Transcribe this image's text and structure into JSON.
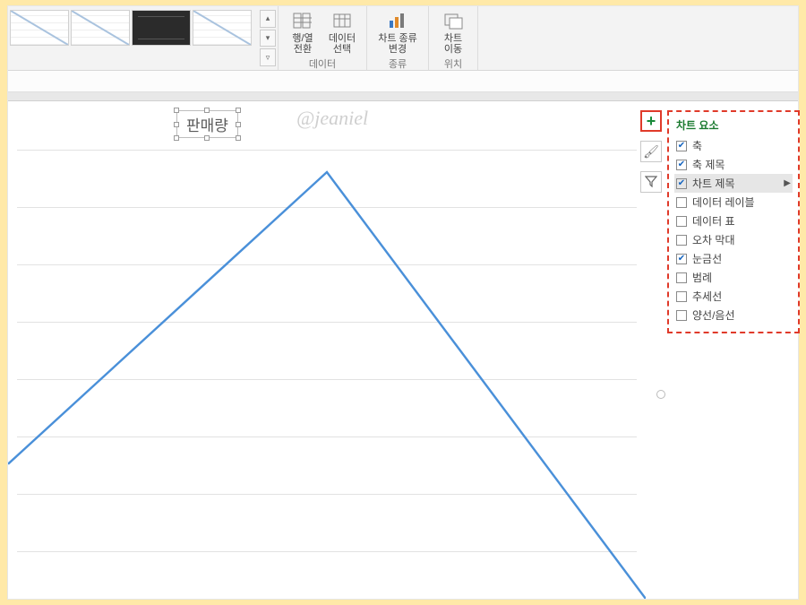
{
  "ribbon": {
    "groups": {
      "data": {
        "btn_switch": "행/열\n전환",
        "btn_select": "데이터\n선택",
        "caption": "데이터"
      },
      "type": {
        "btn_change": "차트 종류\n변경",
        "caption": "종류"
      },
      "loc": {
        "btn_move": "차트\n이동",
        "caption": "위치"
      }
    }
  },
  "chart_title": "판매량",
  "watermark": "@jeaniel",
  "float": {
    "plus": "+",
    "brush": "🖌",
    "filter": "▾"
  },
  "menu": {
    "title": "차트 요소",
    "items": [
      {
        "label": "축",
        "checked": true,
        "sel": false,
        "fly": false
      },
      {
        "label": "축 제목",
        "checked": true,
        "sel": false,
        "fly": false
      },
      {
        "label": "차트 제목",
        "checked": true,
        "sel": true,
        "fly": true
      },
      {
        "label": "데이터 레이블",
        "checked": false,
        "sel": false,
        "fly": false
      },
      {
        "label": "데이터 표",
        "checked": false,
        "sel": false,
        "fly": false
      },
      {
        "label": "오차 막대",
        "checked": false,
        "sel": false,
        "fly": false
      },
      {
        "label": "눈금선",
        "checked": true,
        "sel": false,
        "fly": false
      },
      {
        "label": "범례",
        "checked": false,
        "sel": false,
        "fly": false
      },
      {
        "label": "추세선",
        "checked": false,
        "sel": false,
        "fly": false
      },
      {
        "label": "양선/음선",
        "checked": false,
        "sel": false,
        "fly": false
      }
    ]
  },
  "chart_data": {
    "type": "line",
    "title": "판매량",
    "series": [
      {
        "name": "판매량",
        "x": [
          0,
          1,
          2
        ],
        "y": [
          30,
          95,
          0
        ]
      }
    ],
    "xlim": [
      0,
      2
    ],
    "ylim": [
      0,
      100
    ],
    "grid": true
  }
}
